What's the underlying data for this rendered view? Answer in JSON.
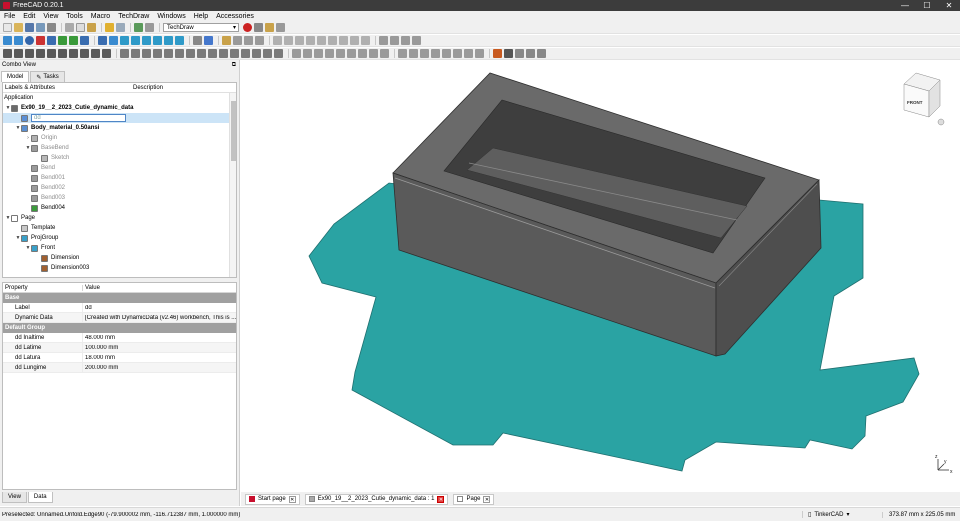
{
  "window": {
    "title": "FreeCAD 0.20.1",
    "min": "—",
    "max": "☐",
    "close": "✕"
  },
  "menu": [
    "File",
    "Edit",
    "View",
    "Tools",
    "Macro",
    "TechDraw",
    "Windows",
    "Help",
    "Accessories"
  ],
  "workbench_selector": {
    "value": "TechDraw"
  },
  "combo_view": {
    "title": "Combo View",
    "tabs": [
      "Model",
      "Tasks"
    ],
    "tree_headers": [
      "Labels & Attributes",
      "Description"
    ],
    "application_label": "Application",
    "tree": [
      {
        "label": "Ex90_19__2_2023_Cutie_dynamic_data",
        "indent": 0,
        "arrow": "▼",
        "icon_color": "#6b6b6b",
        "style": "bold"
      },
      {
        "label": "dd",
        "indent": 1,
        "arrow": "",
        "icon_color": "#5a8fd6",
        "style": "sel"
      },
      {
        "label": "Body_material_0.50ansi",
        "indent": 1,
        "arrow": "▼",
        "icon_color": "#5b8fd0",
        "style": "bold"
      },
      {
        "label": "Origin",
        "indent": 2,
        "arrow": "›",
        "icon_color": "#b0b0b0",
        "style": "faded"
      },
      {
        "label": "BaseBend",
        "indent": 2,
        "arrow": "▼",
        "icon_color": "#9a9a9a",
        "style": "faded"
      },
      {
        "label": "Sketch",
        "indent": 3,
        "arrow": "",
        "icon_color": "#b8b8b8",
        "style": "faded"
      },
      {
        "label": "Bend",
        "indent": 2,
        "arrow": "",
        "icon_color": "#9a9a9a",
        "style": "faded"
      },
      {
        "label": "Bend001",
        "indent": 2,
        "arrow": "",
        "icon_color": "#9a9a9a",
        "style": "faded"
      },
      {
        "label": "Bend002",
        "indent": 2,
        "arrow": "",
        "icon_color": "#9a9a9a",
        "style": "faded"
      },
      {
        "label": "Bend003",
        "indent": 2,
        "arrow": "",
        "icon_color": "#9a9a9a",
        "style": "faded"
      },
      {
        "label": "Bend004",
        "indent": 2,
        "arrow": "",
        "icon_color": "#3c9a3c",
        "style": "normal"
      },
      {
        "label": "Page",
        "indent": 0,
        "arrow": "▼",
        "icon_color": "#ffffff",
        "style": "normal"
      },
      {
        "label": "Template",
        "indent": 1,
        "arrow": "",
        "icon_color": "#c8c8c8",
        "style": "normal"
      },
      {
        "label": "ProjGroup",
        "indent": 1,
        "arrow": "▼",
        "icon_color": "#3aa0c8",
        "style": "normal"
      },
      {
        "label": "Front",
        "indent": 2,
        "arrow": "▼",
        "icon_color": "#3aa0c8",
        "style": "normal"
      },
      {
        "label": "Dimension",
        "indent": 3,
        "arrow": "",
        "icon_color": "#a06030",
        "style": "normal"
      },
      {
        "label": "Dimension003",
        "indent": 3,
        "arrow": "",
        "icon_color": "#a06030",
        "style": "normal"
      }
    ]
  },
  "properties": {
    "headers": [
      "Property",
      "Value"
    ],
    "groups": [
      {
        "name": "Base",
        "rows": [
          {
            "key": "Label",
            "value": "dd"
          },
          {
            "key": "Dynamic Data",
            "value": "[Created with DynamicData (v2.46) workbench, This is ..."
          }
        ]
      },
      {
        "name": "Default Group",
        "rows": [
          {
            "key": "dd Inaltime",
            "value": "48.000 mm"
          },
          {
            "key": "dd Latime",
            "value": "100.000 mm"
          },
          {
            "key": "dd Latura",
            "value": "18.000 mm"
          },
          {
            "key": "dd Lungime",
            "value": "200.000 mm"
          }
        ]
      }
    ],
    "bottom_tabs": [
      "View",
      "Data"
    ]
  },
  "viewport": {
    "navcube_label": "FRONT",
    "axis_labels": {
      "x": "x",
      "y": "y",
      "z": "z"
    },
    "colors": {
      "box_top": "#6a6a6a",
      "box_side": "#5a5a5a",
      "box_front": "#4e4e4e",
      "unfold": "#2aa3a3"
    }
  },
  "doc_tabs": [
    {
      "label": "Start page",
      "close_red": false
    },
    {
      "label": "Ex90_19__2_2023_Cutie_dynamic_data : 1",
      "close_red": true
    },
    {
      "label": "Page",
      "close_red": false
    }
  ],
  "status": {
    "message": "Preselected: Unnamed.Unfold.Edge90 (-79.900002 mm, -116.712387 mm, 1.000000 mm)",
    "nav_style": "TinkerCAD",
    "dims": "373.87 mm x 225.05 mm"
  }
}
